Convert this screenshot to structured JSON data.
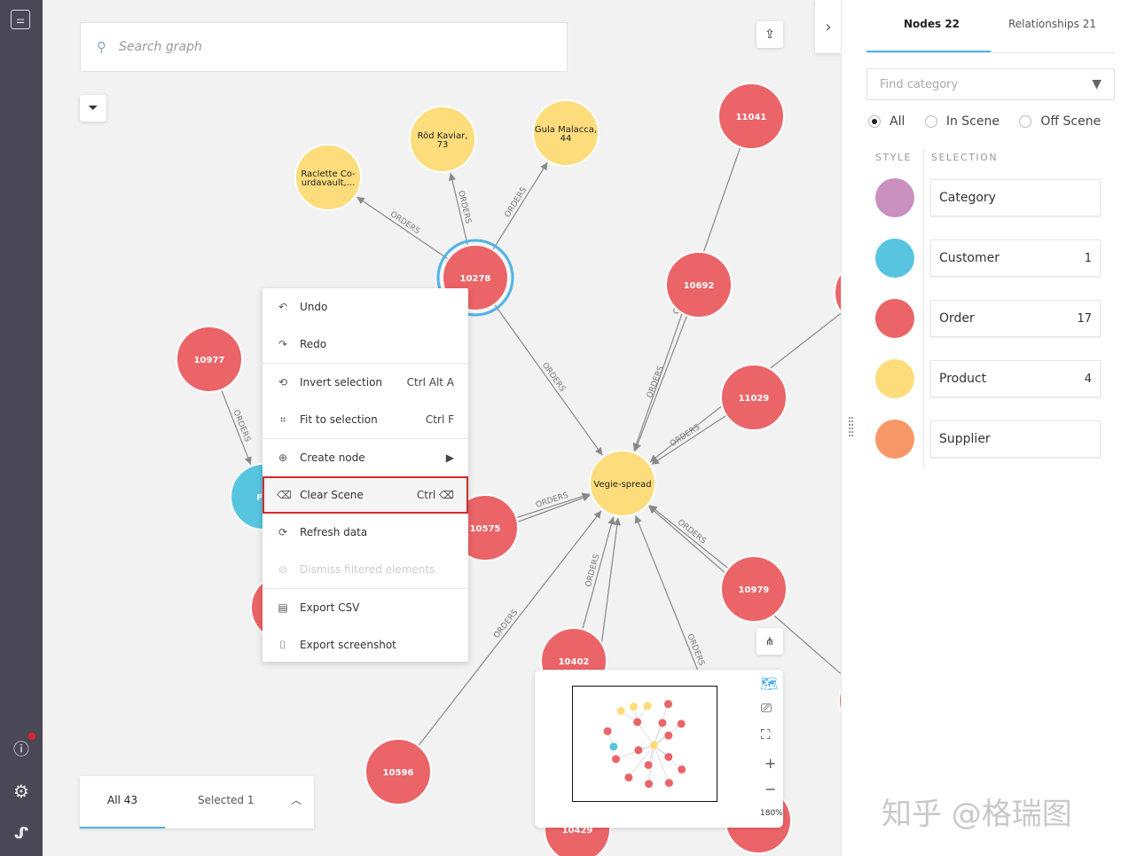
{
  "search": {
    "placeholder": "Search graph"
  },
  "graph": {
    "edge_label": "ORDERS",
    "colors": {
      "Order": "#eb6468",
      "Product": "#fddc7c",
      "Customer": "#58c5e0",
      "Category": "#c990c0",
      "Supplier": "#f79767",
      "edge": "#888888",
      "selected_ring": "#4fb3e8"
    },
    "nodes": [
      {
        "id": "n10278",
        "label": "10278",
        "category": "Order",
        "selected": true
      },
      {
        "id": "raclette",
        "label": "Raclette Co-urdavault,...",
        "category": "Product"
      },
      {
        "id": "rod",
        "label": "Röd Kaviar, 73",
        "category": "Product"
      },
      {
        "id": "gula",
        "label": "Gula Malacca, 44",
        "category": "Product"
      },
      {
        "id": "n11041",
        "label": "11041",
        "category": "Order"
      },
      {
        "id": "n10692",
        "label": "10692",
        "category": "Order"
      },
      {
        "id": "n10977",
        "label": "10977",
        "category": "Order"
      },
      {
        "id": "n11029",
        "label": "11029",
        "category": "Order"
      },
      {
        "id": "vegie",
        "label": "Vegie-spread",
        "category": "Product"
      },
      {
        "id": "fo",
        "label": "FO",
        "category": "Customer"
      },
      {
        "id": "n10575",
        "label": "10575",
        "category": "Order"
      },
      {
        "id": "n10979",
        "label": "10979",
        "category": "Order"
      },
      {
        "id": "n10402",
        "label": "10402",
        "category": "Order"
      },
      {
        "id": "n10596",
        "label": "10596",
        "category": "Order"
      },
      {
        "id": "n10429",
        "label": "10429",
        "category": "Order"
      },
      {
        "id": "o1",
        "label": "",
        "category": "Order"
      },
      {
        "id": "o2",
        "label": "",
        "category": "Order"
      },
      {
        "id": "o3",
        "label": "",
        "category": "Order"
      },
      {
        "id": "o4",
        "label": "",
        "category": "Order"
      }
    ]
  },
  "context_menu": {
    "items": [
      {
        "label": "Undo",
        "icon": "undo-icon",
        "shortcut": ""
      },
      {
        "label": "Redo",
        "icon": "redo-icon",
        "shortcut": ""
      },
      {
        "label": "Invert selection",
        "icon": "invert-selection-icon",
        "shortcut": "Ctrl Alt A"
      },
      {
        "label": "Fit to selection",
        "icon": "fit-selection-icon",
        "shortcut": "Ctrl F"
      },
      {
        "label": "Create node",
        "icon": "plus-circle-icon",
        "shortcut": ""
      },
      {
        "label": "Clear Scene",
        "icon": "eraser-icon",
        "shortcut": "Ctrl ⌫"
      },
      {
        "label": "Refresh data",
        "icon": "refresh-icon",
        "shortcut": ""
      },
      {
        "label": "Dismiss filtered elements",
        "icon": "dismiss-icon",
        "shortcut": "",
        "disabled": true
      },
      {
        "label": "Export CSV",
        "icon": "csv-icon",
        "shortcut": ""
      },
      {
        "label": "Export screenshot",
        "icon": "camera-icon",
        "shortcut": ""
      }
    ]
  },
  "bottom_bar": {
    "all": "All 43",
    "selected": "Selected 1"
  },
  "minimap": {
    "zoom": "180%"
  },
  "panel": {
    "tabs": [
      {
        "label": "Nodes 22",
        "active": true
      },
      {
        "label": "Relationships 21"
      }
    ],
    "find_placeholder": "Find category",
    "filters": [
      {
        "label": "All",
        "checked": true
      },
      {
        "label": "In Scene"
      },
      {
        "label": "Off Scene"
      }
    ],
    "col_style": "STYLE",
    "col_selection": "SELECTION",
    "categories": [
      {
        "name": "Category",
        "count": "",
        "color": "#c990c0"
      },
      {
        "name": "Customer",
        "count": "1",
        "color": "#58c5e0"
      },
      {
        "name": "Order",
        "count": "17",
        "color": "#eb6468"
      },
      {
        "name": "Product",
        "count": "4",
        "color": "#fddc7c"
      },
      {
        "name": "Supplier",
        "count": "",
        "color": "#f79767"
      }
    ]
  },
  "watermark": "知乎 @格瑞图"
}
